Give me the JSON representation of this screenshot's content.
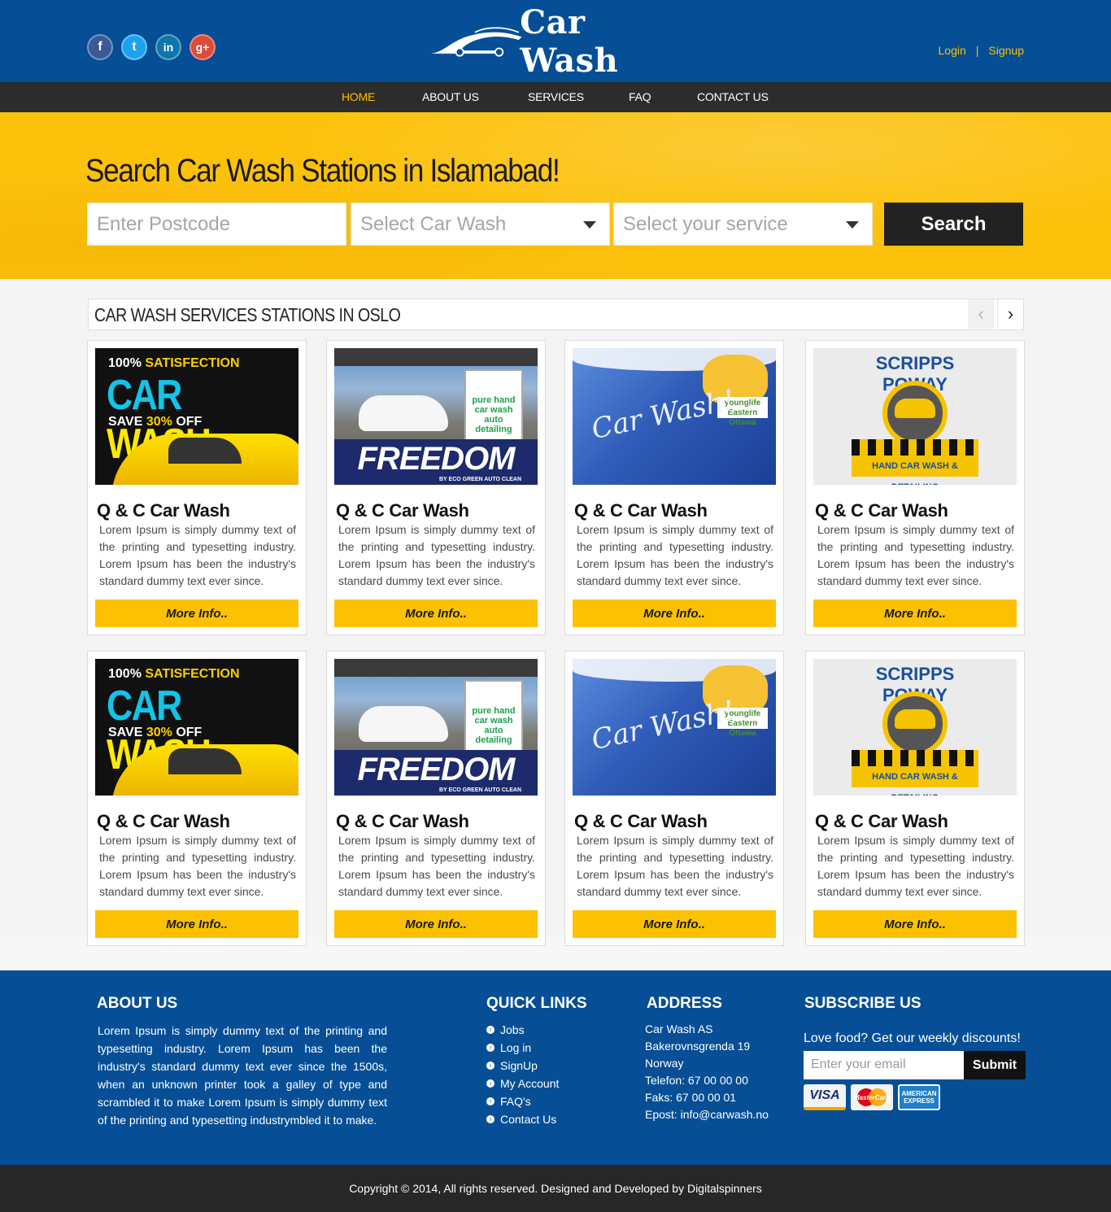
{
  "header": {
    "logo_text": "Car Wash",
    "social": [
      "f",
      "t",
      "in",
      "g+"
    ],
    "login": "Login",
    "separator": "|",
    "signup": "Signup"
  },
  "nav": {
    "items": [
      "HOME",
      "ABOUT US",
      "SERVICES",
      "FAQ",
      "CONTACT US"
    ],
    "active": "HOME"
  },
  "hero": {
    "title": "Search Car Wash Stations in Islamabad!",
    "postcode_placeholder": "Enter Postcode",
    "car_wash_select": "Select Car Wash",
    "service_select": "Select your service",
    "search_label": "Search"
  },
  "section": {
    "title": "CAR WASH SERVICES STATIONS IN OSLO",
    "prev": "‹",
    "next": "›"
  },
  "card_images": {
    "img1": {
      "line1": "100%",
      "line1b": "SATISFECTION",
      "car": "CAR",
      "wash": "WASH",
      "save": "SAVE",
      "pct": "30%",
      "off": "OFF"
    },
    "img2": {
      "sign": "pure hand car wash auto detailing",
      "brand": "FREEDOM",
      "sub": "BY ECO GREEN AUTO CLEAN"
    },
    "img3": {
      "script": "Car Wash!",
      "badge": "younglife Eastern Ottawa"
    },
    "img4": {
      "arc": "SCRIPPS POWAY",
      "label": "HAND CAR WASH & DETAILING"
    }
  },
  "cards": [
    {
      "title": "Q & C Car Wash",
      "text": "Lorem Ipsum is simply dummy text of the printing and typesetting industry. Lorem Ipsum has been the industry's standard dummy text ever since.",
      "button": "More Info.."
    },
    {
      "title": "Q & C Car Wash",
      "text": "Lorem Ipsum is simply dummy text of the printing and typesetting industry. Lorem Ipsum has been the industry's standard dummy text ever since.",
      "button": "More Info.."
    },
    {
      "title": "Q & C Car Wash",
      "text": "Lorem Ipsum is simply dummy text of the printing and typesetting industry. Lorem Ipsum has been the industry's standard dummy text ever since.",
      "button": "More Info.."
    },
    {
      "title": "Q & C Car Wash",
      "text": "Lorem Ipsum is simply dummy text of the printing and typesetting industry. Lorem Ipsum has been the industry's standard dummy text ever since.",
      "button": "More Info.."
    },
    {
      "title": "Q & C Car Wash",
      "text": "Lorem Ipsum is simply dummy text of the printing and typesetting industry. Lorem Ipsum has been the industry's standard dummy text ever since.",
      "button": "More Info.."
    },
    {
      "title": "Q & C Car Wash",
      "text": "Lorem Ipsum is simply dummy text of the printing and typesetting industry. Lorem Ipsum has been the industry's standard dummy text ever since.",
      "button": "More Info.."
    },
    {
      "title": "Q & C Car Wash",
      "text": "Lorem Ipsum is simply dummy text of the printing and typesetting industry. Lorem Ipsum has been the industry's standard dummy text ever since.",
      "button": "More Info.."
    },
    {
      "title": "Q & C Car Wash",
      "text": "Lorem Ipsum is simply dummy text of the printing and typesetting industry. Lorem Ipsum has been the industry's standard dummy text ever since.",
      "button": "More Info.."
    }
  ],
  "footer": {
    "about_title": "ABOUT US",
    "about_text": "Lorem Ipsum is simply dummy text of the printing and typesetting industry. Lorem Ipsum has been the industry's standard dummy text ever since the 1500s, when an unknown printer took a galley of type and scrambled it to make Lorem Ipsum is simply dummy text of the printing and typesetting industrymbled it to make.",
    "links_title": "QUICK LINKS",
    "links": [
      "Jobs",
      "Log in",
      "SignUp",
      "My Account",
      "FAQ's",
      "Contact Us"
    ],
    "address_title": "ADDRESS",
    "address": [
      "Car Wash AS",
      "Bakerovnsgrenda 19",
      "Norway",
      "Telefon: 67 00 00 00",
      "Faks: 67 00 00 01",
      "Epost: info@carwash.no"
    ],
    "subscribe_title": "SUBSCRIBE US",
    "subscribe_text": "Love food? Get our weekly discounts!",
    "email_placeholder": "Enter your email",
    "submit": "Submit",
    "payments": {
      "visa": "VISA",
      "mastercard": "MasterCard",
      "amex": "AMERICAN EXPRESS"
    }
  },
  "copyright": "Copyright © 2014, All rights reserved. Designed and Developed by Digitalspinners",
  "colors": {
    "brand_blue": "#064f96",
    "accent_yellow": "#fcc100",
    "dark": "#2c2c2c"
  }
}
